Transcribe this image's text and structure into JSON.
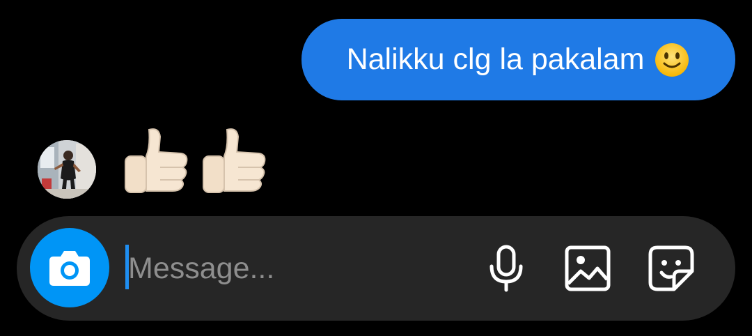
{
  "thread": {
    "sent_message": {
      "text": "Nalikku clg la pakalam",
      "emoji": "slightly-smiling-face-emoji"
    },
    "received_reaction": {
      "emoji": [
        "thumbs-up-emoji",
        "thumbs-up-emoji"
      ]
    }
  },
  "composer": {
    "placeholder": "Message...",
    "value": "",
    "camera_icon": "camera-icon",
    "mic_icon": "microphone-icon",
    "gallery_icon": "gallery-icon",
    "sticker_icon": "sticker-icon"
  },
  "colors": {
    "background": "#000000",
    "sent_bubble": "#1f7ae6",
    "composer_bg": "#262626",
    "camera_button": "#0095f6",
    "placeholder": "#8e8e8e",
    "cursor": "#1f8ef1"
  }
}
